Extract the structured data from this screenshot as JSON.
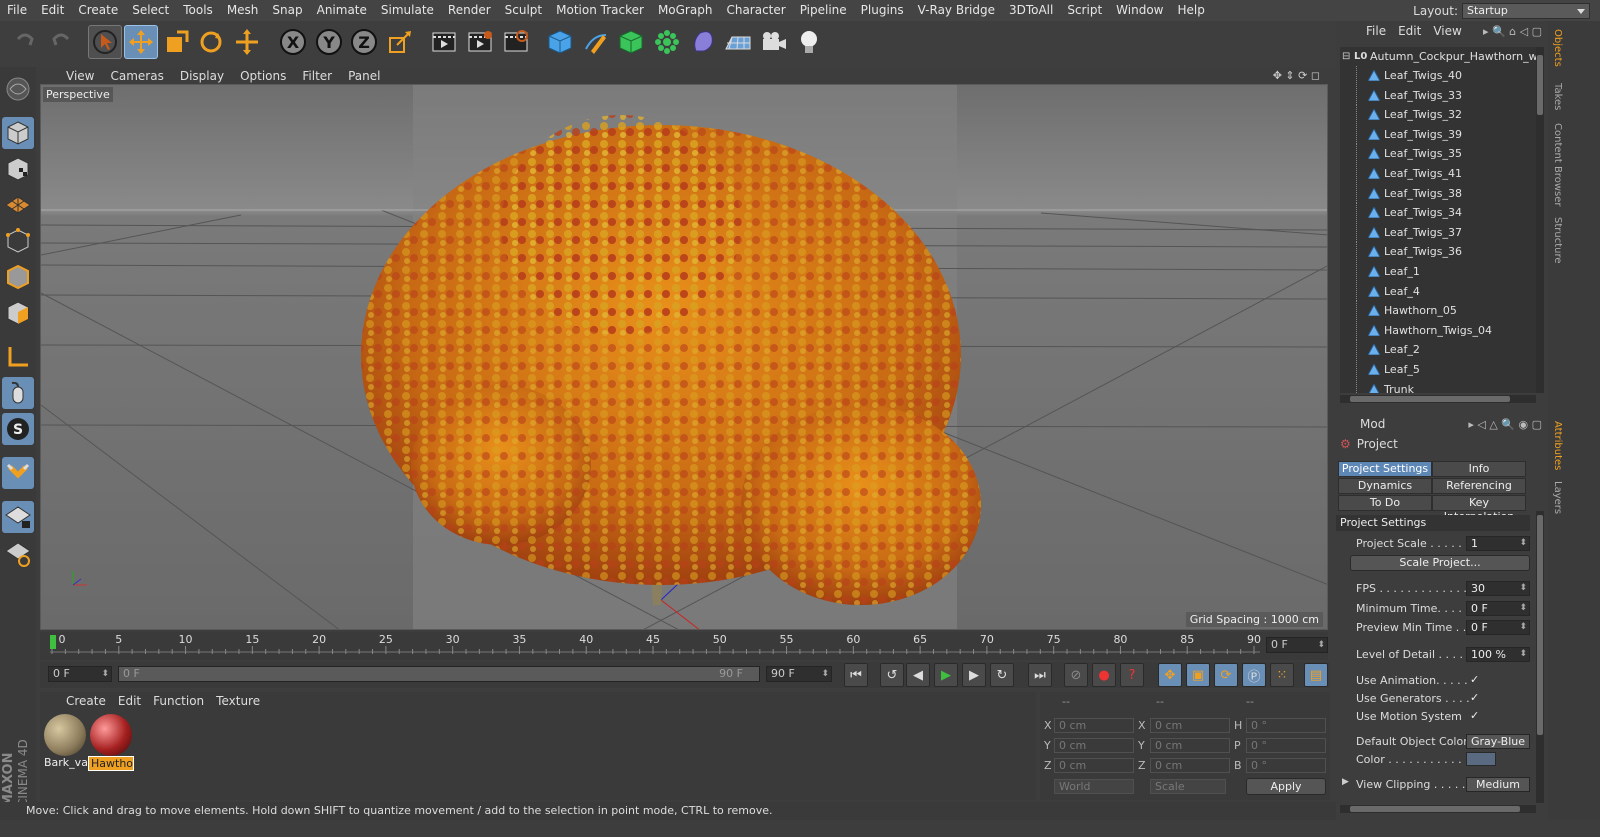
{
  "menubar": {
    "items": [
      "File",
      "Edit",
      "Create",
      "Select",
      "Tools",
      "Mesh",
      "Snap",
      "Animate",
      "Simulate",
      "Render",
      "Sculpt",
      "Motion Tracker",
      "MoGraph",
      "Character",
      "Pipeline",
      "Plugins",
      "V-Ray Bridge",
      "3DToAll",
      "Script",
      "Window",
      "Help"
    ],
    "layout_label": "Layout:",
    "layout_value": "Startup"
  },
  "toolbar": {
    "axis_x": "X",
    "axis_y": "Y",
    "axis_z": "Z"
  },
  "viewport_menu": [
    "View",
    "Cameras",
    "Display",
    "Options",
    "Filter",
    "Panel"
  ],
  "viewport": {
    "label": "Perspective",
    "grid_spacing": "Grid Spacing : 1000 cm"
  },
  "timeline": {
    "ticks": [
      "0",
      "5",
      "10",
      "15",
      "20",
      "25",
      "30",
      "35",
      "40",
      "45",
      "50",
      "55",
      "60",
      "65",
      "70",
      "75",
      "80",
      "85",
      "90"
    ],
    "end_field": "0 F"
  },
  "playbar": {
    "current_frame": "0 F",
    "range_start": "0 F",
    "range_end": "90 F",
    "max_frame": "90 F"
  },
  "material_manager": {
    "menu": [
      "Create",
      "Edit",
      "Function",
      "Texture"
    ],
    "materials": [
      {
        "name": "Bark_var",
        "color": "#8a7a5a"
      },
      {
        "name": "Hawtho",
        "color": "#a52020"
      }
    ],
    "brand_top": "MAXON",
    "brand_bottom": "CINEMA 4D"
  },
  "coordinates": {
    "header": [
      "--",
      "--",
      "--"
    ],
    "rows": [
      {
        "a": "X",
        "av": "0 cm",
        "b": "X",
        "bv": "0 cm",
        "c": "H",
        "cv": "0 °"
      },
      {
        "a": "Y",
        "av": "0 cm",
        "b": "Y",
        "bv": "0 cm",
        "c": "P",
        "cv": "0 °"
      },
      {
        "a": "Z",
        "av": "0 cm",
        "b": "Z",
        "bv": "0 cm",
        "c": "B",
        "cv": "0 °"
      }
    ],
    "mode1": "World",
    "mode2": "Scale",
    "apply": "Apply"
  },
  "status": "Move: Click and drag to move elements. Hold down SHIFT to quantize movement / add to the selection in point mode, CTRL to remove.",
  "object_manager": {
    "menu": [
      "File",
      "Edit",
      "View"
    ],
    "root": "Autumn_Cockpur_Hawthorn_wi",
    "items": [
      "Leaf_Twigs_40",
      "Leaf_Twigs_33",
      "Leaf_Twigs_32",
      "Leaf_Twigs_39",
      "Leaf_Twigs_35",
      "Leaf_Twigs_41",
      "Leaf_Twigs_38",
      "Leaf_Twigs_34",
      "Leaf_Twigs_37",
      "Leaf_Twigs_36",
      "Leaf_1",
      "Leaf_4",
      "Hawthorn_05",
      "Hawthorn_Twigs_04",
      "Leaf_2",
      "Leaf_5",
      "Trunk"
    ]
  },
  "attributes": {
    "mode_label": "Mod",
    "title": "Project",
    "tabs": [
      "Project Settings",
      "Info",
      "Dynamics",
      "Referencing",
      "To Do",
      "Key Interpolation"
    ],
    "section": "Project Settings",
    "project_scale_label": "Project Scale . . . . . .",
    "project_scale_value": "1",
    "scale_button": "Scale Project...",
    "fps_label": "FPS . . . . . . . . . . . . .",
    "fps_value": "30",
    "min_time_label": "Minimum Time. . . . .",
    "min_time_value": "0 F",
    "preview_min_label": "Preview Min Time . .",
    "preview_min_value": "0 F",
    "lod_label": "Level of Detail . . . . .",
    "lod_value": "100 %",
    "use_animation": "Use Animation. . . . .",
    "use_generators": "Use Generators . . . .",
    "use_motion": "Use Motion System",
    "check": "✓",
    "default_color_label": "Default Object Color",
    "default_color_value": "Gray-Blue",
    "color_label": "Color . . . . . . . . . . .",
    "view_clipping_label": "View Clipping . . . . .",
    "view_clipping_value": "Medium"
  },
  "side_tabs": [
    "Objects",
    "Takes",
    "Content Browser",
    "Structure",
    "Attributes",
    "Layers"
  ]
}
